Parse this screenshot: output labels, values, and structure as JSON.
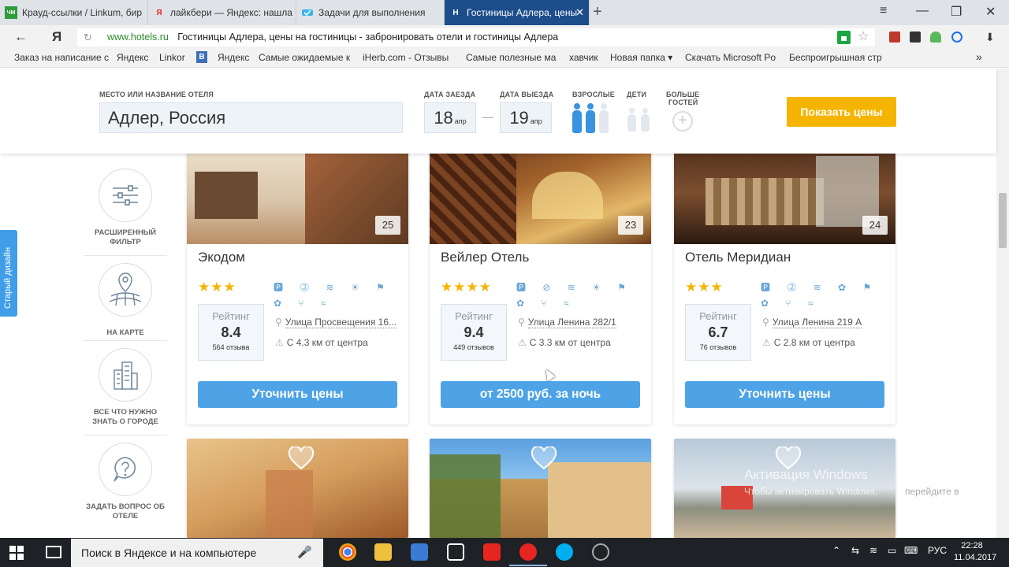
{
  "browser": {
    "tabs": [
      {
        "title": "Крауд-ссылки / Linkum, бир",
        "fav_text": "ЧМ",
        "fav_color": "#2e9b3a"
      },
      {
        "title": "лайкбери — Яндекс: нашла",
        "fav_text": "Я",
        "fav_color": "#e52620"
      },
      {
        "title": "Задачи для выполнения",
        "fav_text": "",
        "fav_color": "#3ab3e8"
      },
      {
        "title": "Гостиницы Адлера, цены",
        "fav_text": "H",
        "fav_color": "#1d4e8b"
      }
    ],
    "new_tab": "+",
    "window_controls": {
      "menu": "≡",
      "minimize": "—",
      "restore": "❐",
      "close": "✕"
    },
    "back": "←",
    "yandex_logo": "Я",
    "url_domain": "www.hotels.ru",
    "url_title": "Гостиницы Адлера, цены на гостиницы - забронировать отели и гостиницы Адлера",
    "download": "⬇",
    "bookmarks": [
      "Заказ на написание ста",
      "Яндекс",
      "Linkor",
      "B",
      "Яндекс",
      "Самые ожидаемые к",
      "iHerb.com - Отзывы",
      "Самые полезные ма",
      "хавчик",
      "Новая папка ▾",
      "Скачать Microsoft Po",
      "Беспроигрышная стр"
    ],
    "bookmarks_more": "»"
  },
  "search": {
    "dest_label": "Место или название отеля",
    "dest_value": "Адлер, Россия",
    "checkin_label": "Дата заезда",
    "checkin_day": "18",
    "checkin_month": "апр",
    "checkout_label": "Дата выезда",
    "checkout_day": "19",
    "checkout_month": "апр",
    "adults_label": "Взрослые",
    "kids_label": "Дети",
    "more_label_1": "Больше",
    "more_label_2": "гостей",
    "show_button": "Показать цены"
  },
  "side_tab": "Старый дизайн",
  "sidebar": [
    {
      "line1": "Расширенный",
      "line2": "фильтр",
      "icon": "sliders-icon"
    },
    {
      "line1": "На карте",
      "line2": "",
      "icon": "map-pin-icon"
    },
    {
      "line1": "Все что нужно",
      "line2": "знать о городе",
      "icon": "city-icon"
    },
    {
      "line1": "Задать вопрос об",
      "line2": "отеле",
      "icon": "question-icon"
    }
  ],
  "hotels": [
    {
      "name": "Экодом",
      "stars": "★★★",
      "amenities": "🅿 ⓶ ≋ ☀ ⚑ ✿ ⑂ ≈",
      "rating_label": "Рейтинг",
      "rating_value": "8.4",
      "reviews": "564 отзыва",
      "address": "Улица Просвещения 16...",
      "distance": "С 4.3 км от центра",
      "price_button": "Уточнить цены",
      "photo_count": "25"
    },
    {
      "name": "Вейлер Отель",
      "stars": "★★★★",
      "amenities": "🅿 ⊘ ≋ ☀ ⚑ ✿ ⑂ ≈",
      "rating_label": "Рейтинг",
      "rating_value": "9.4",
      "reviews": "449 отзывов",
      "address": "Улица Ленина 282/1",
      "distance": "С 3.3 км от центра",
      "price_button": "от 2500 руб. за ночь",
      "photo_count": "23"
    },
    {
      "name": "Отель Меридиан",
      "stars": "★★★",
      "amenities": "🅿 ⓶ ≋ ✿ ⚑ ✿ ⑂ ≈",
      "rating_label": "Рейтинг",
      "rating_value": "6.7",
      "reviews": "76 отзывов",
      "address": "Улица Ленина 219 А",
      "distance": "С 2.8 км от центра",
      "price_button": "Уточнить цены",
      "photo_count": "24"
    }
  ],
  "watermark": {
    "line1": "Активация Windows",
    "line2": "Чтобы активировать Windows,",
    "line2b": "перейдите в"
  },
  "taskbar": {
    "search_placeholder": "Поиск в Яндексе и на компьютере",
    "lang": "РУС",
    "time": "22:28",
    "date": "11.04.2017"
  }
}
